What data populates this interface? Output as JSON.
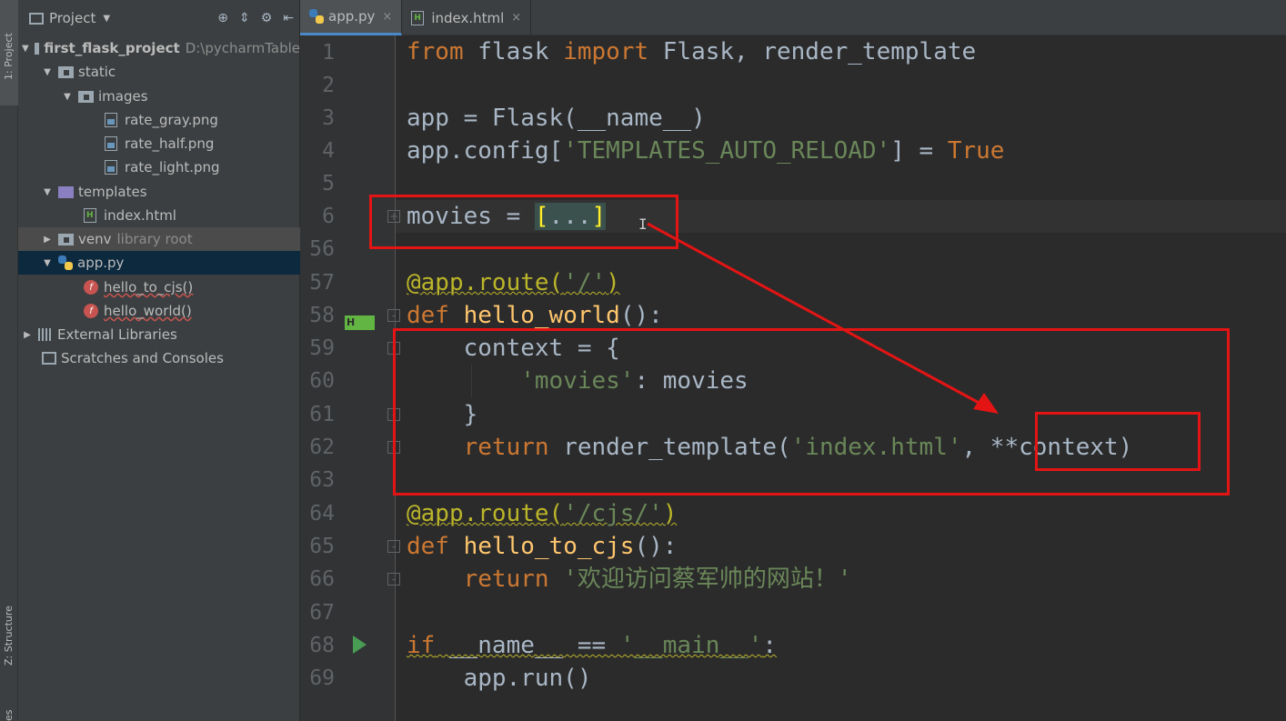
{
  "side_strip": {
    "project_tab": "1: Project",
    "structure_tab": "Z: Structure",
    "favorites_tab": "es"
  },
  "project_panel": {
    "title": "Project",
    "tree": [
      {
        "label": "first_flask_project",
        "hint": "D:\\pycharmTable",
        "icon": "folder-icon",
        "depth": 0
      },
      {
        "label": "static",
        "icon": "folder-icon",
        "depth": 1
      },
      {
        "label": "images",
        "icon": "folder-icon",
        "depth": 2
      },
      {
        "label": "rate_gray.png",
        "icon": "image-file-icon",
        "depth": 3
      },
      {
        "label": "rate_half.png",
        "icon": "image-file-icon",
        "depth": 3
      },
      {
        "label": "rate_light.png",
        "icon": "image-file-icon",
        "depth": 3
      },
      {
        "label": "templates",
        "icon": "folder-icon",
        "depth": 1
      },
      {
        "label": "index.html",
        "icon": "html-file-icon",
        "depth": 2
      },
      {
        "label": "venv",
        "hint": "library root",
        "icon": "folder-icon",
        "depth": 1
      },
      {
        "label": "app.py",
        "icon": "python-file-icon",
        "depth": 1
      },
      {
        "label": "hello_to_cjs()",
        "icon": "function-icon",
        "depth": 2
      },
      {
        "label": "hello_world()",
        "icon": "function-icon",
        "depth": 2
      },
      {
        "label": "External Libraries",
        "icon": "library-icon",
        "depth": 0
      },
      {
        "label": "Scratches and Consoles",
        "icon": "scratch-icon",
        "depth": 0
      }
    ]
  },
  "tabs": [
    {
      "label": "app.py",
      "close": "×",
      "active": true
    },
    {
      "label": "index.html",
      "close": "×",
      "active": false
    }
  ],
  "editor": {
    "line_numbers": [
      "1",
      "2",
      "3",
      "4",
      "5",
      "6",
      "56",
      "57",
      "58",
      "59",
      "60",
      "61",
      "62",
      "63",
      "64",
      "65",
      "66",
      "67",
      "68",
      "69"
    ],
    "lines": {
      "l1": {
        "from": "from",
        "module": " flask ",
        "import": "import",
        "rest": " Flask, render_template"
      },
      "l3": {
        "text": "app = Flask(__name__)"
      },
      "l4": {
        "a": "app.config[",
        "s": "'TEMPLATES_AUTO_RELOAD'",
        "b": "] = ",
        "t": "True"
      },
      "l6": {
        "a": "movies = ",
        "open": "[",
        "dots": "...",
        "close": "]"
      },
      "l57": {
        "deco": "@app.route(",
        "s": "'/'",
        "close": ")"
      },
      "l58": {
        "def": "def",
        "name": " hello_world",
        "rest": "():"
      },
      "l59": {
        "text": "    context = {"
      },
      "l60": {
        "indent": "        ",
        "s": "'movies'",
        "rest": ": movies"
      },
      "l61": {
        "text": "    }"
      },
      "l62": {
        "indent": "    ",
        "ret": "return",
        "a": " render_template(",
        "s": "'index.html'",
        "b": ", **context)"
      },
      "l64": {
        "deco": "@app.route(",
        "s": "'/cjs/'",
        "close": ")"
      },
      "l65": {
        "def": "def",
        "name": " hello_to_cjs",
        "rest": "():"
      },
      "l66": {
        "indent": "    ",
        "ret": "return",
        "s": " '欢迎访问蔡军帅的网站！'"
      },
      "l68": {
        "if": "if",
        "a": " __name__ == ",
        "s": "'__main__'",
        "b": ":"
      },
      "l69": {
        "text": "    app.run()"
      }
    },
    "gutter_badge": "H"
  },
  "colors": {
    "annotation_red": "#e51414",
    "keyword": "#cc7832",
    "string": "#6a8759",
    "decorator": "#bbb529",
    "function_name": "#ffc66d"
  }
}
